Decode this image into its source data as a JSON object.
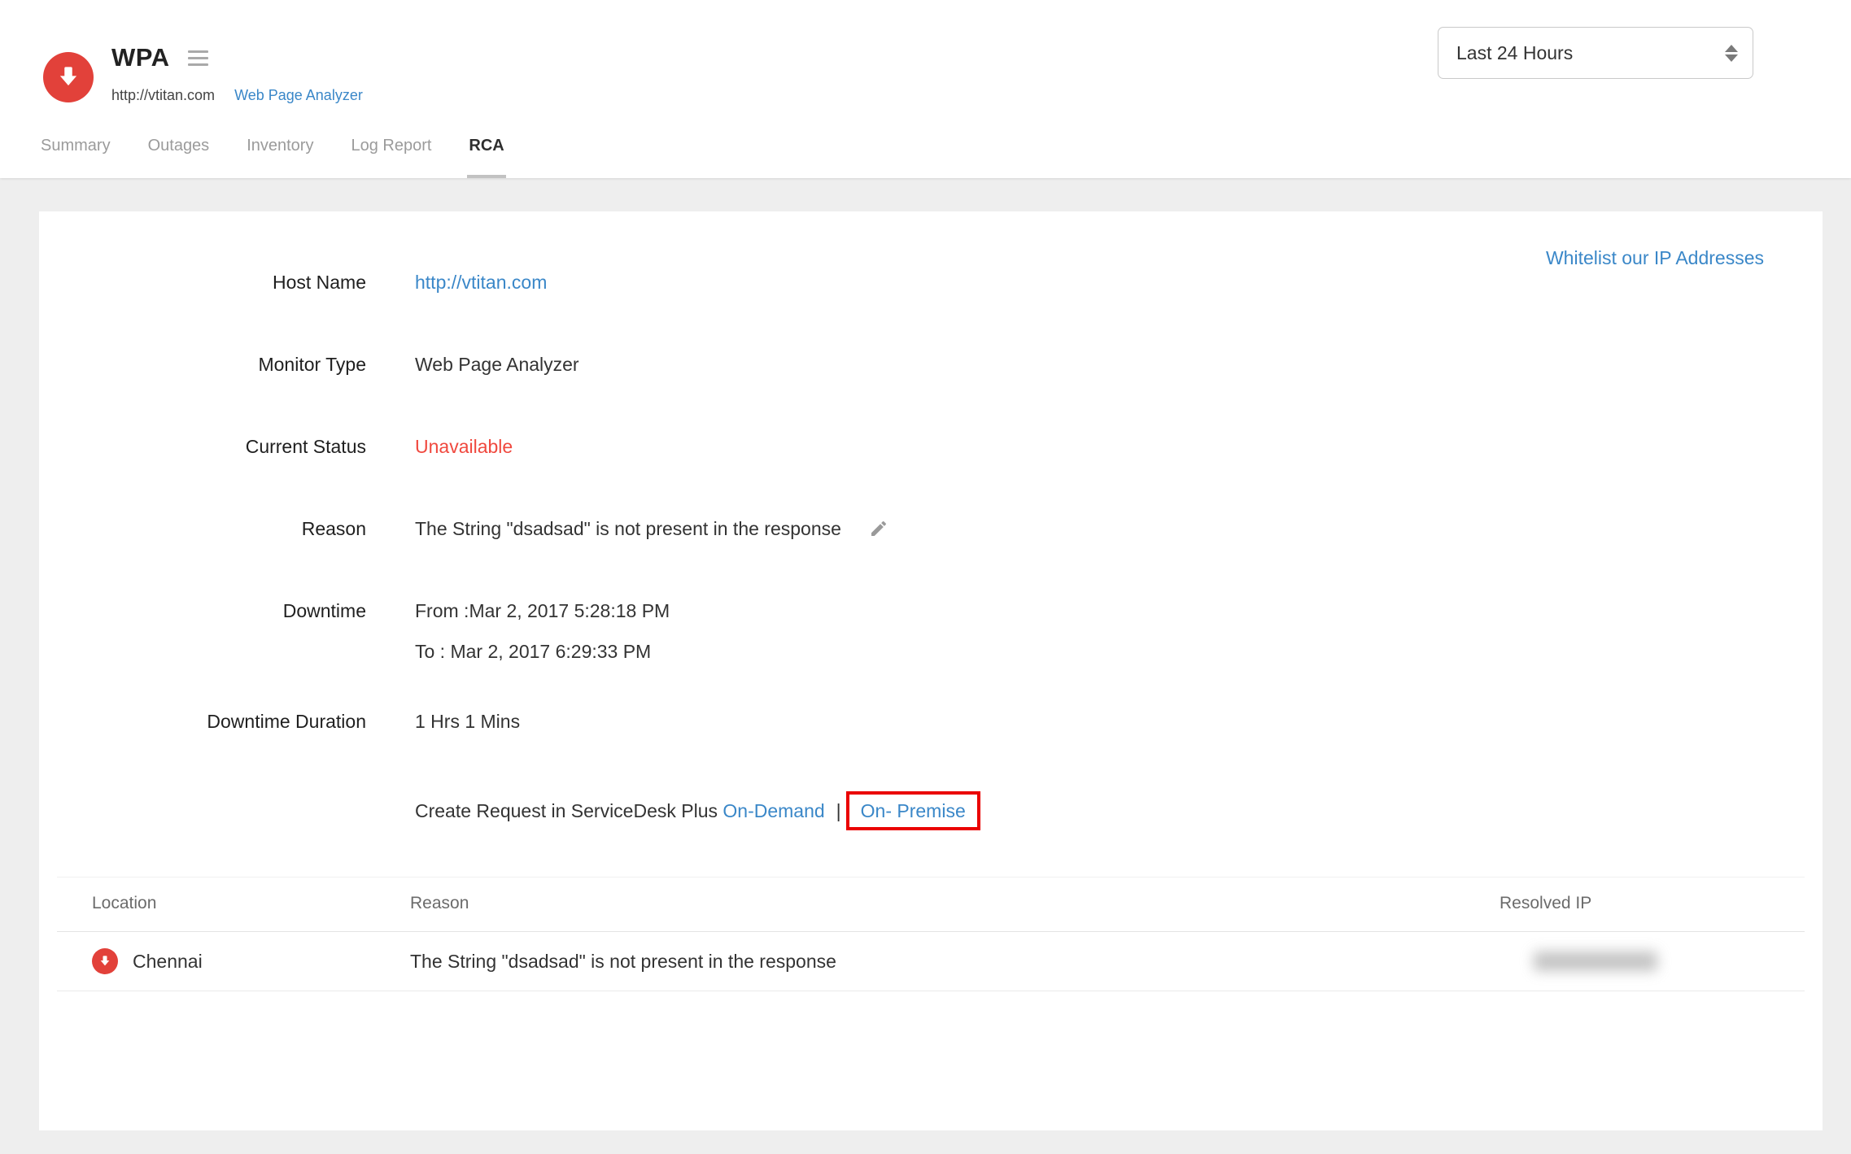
{
  "header": {
    "monitor_name": "WPA",
    "monitor_url": "http://vtitan.com",
    "monitor_type_link": "Web Page Analyzer",
    "tabs": [
      {
        "label": "Summary",
        "active": false
      },
      {
        "label": "Outages",
        "active": false
      },
      {
        "label": "Inventory",
        "active": false
      },
      {
        "label": "Log Report",
        "active": false
      },
      {
        "label": "RCA",
        "active": true
      }
    ],
    "time_range_selected": "Last 24 Hours"
  },
  "card": {
    "whitelist_link": "Whitelist our IP Addresses",
    "fields": {
      "host_name": {
        "label": "Host Name",
        "value": "http://vtitan.com"
      },
      "monitor_type": {
        "label": "Monitor Type",
        "value": "Web Page Analyzer"
      },
      "current_status": {
        "label": "Current Status",
        "value": "Unavailable"
      },
      "reason": {
        "label": "Reason",
        "value": "The String \"dsadsad\" is not present in the response"
      },
      "downtime": {
        "label": "Downtime",
        "from": "From :Mar 2, 2017 5:28:18 PM",
        "to": "To : Mar 2, 2017 6:29:33 PM"
      },
      "downtime_duration": {
        "label": "Downtime Duration",
        "value": "1 Hrs 1 Mins"
      }
    },
    "create_request": {
      "prefix": "Create Request in ServiceDesk Plus",
      "on_demand": "On-Demand",
      "separator": "|",
      "on_premise": "On- Premise"
    }
  },
  "table": {
    "headers": {
      "location": "Location",
      "reason": "Reason",
      "resolved_ip": "Resolved IP"
    },
    "rows": [
      {
        "location": "Chennai",
        "reason": "The String \"dsadsad\" is not present in the response",
        "resolved_ip_redacted": true
      }
    ]
  },
  "colors": {
    "link_blue": "#3a87c8",
    "status_red": "#f0483e",
    "monitor_icon_red": "#e2413a",
    "highlight_box_red": "#ea0000",
    "page_background": "#eeeeee"
  }
}
